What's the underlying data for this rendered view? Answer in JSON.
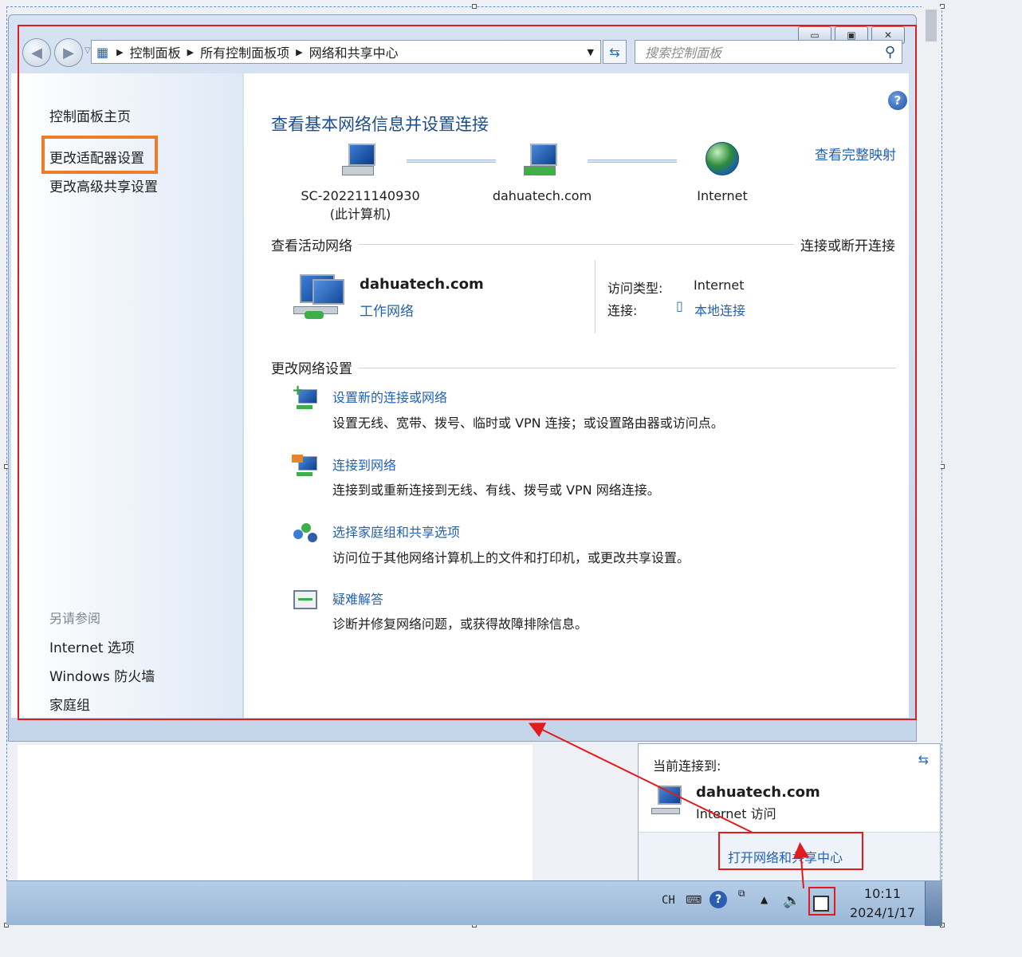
{
  "window": {
    "minimize_icon": "minimize-icon",
    "maximize_icon": "maximize-icon",
    "close_icon": "close-icon"
  },
  "address_bar": {
    "segments": [
      "控制面板",
      "所有控制面板项",
      "网络和共享中心"
    ],
    "search_placeholder": "搜索控制面板"
  },
  "sidebar": {
    "home": "控制面板主页",
    "change_adapter": "更改适配器设置",
    "change_advanced": "更改高级共享设置",
    "see_also_label": "另请参阅",
    "see_also": [
      "Internet 选项",
      "Windows 防火墙",
      "家庭组"
    ]
  },
  "main": {
    "heading": "查看基本网络信息并设置连接",
    "full_map": "查看完整映射",
    "map": {
      "computer_name": "SC-202211140930",
      "computer_sub": "(此计算机)",
      "network_name": "dahuatech.com",
      "internet": "Internet"
    },
    "active_title": "查看活动网络",
    "connect_disconnect": "连接或断开连接",
    "active_network": {
      "name": "dahuatech.com",
      "type": "工作网络",
      "access_label": "访问类型:",
      "access_value": "Internet",
      "conn_label": "连接:",
      "conn_value": "本地连接"
    },
    "change_title": "更改网络设置",
    "tasks": [
      {
        "title": "设置新的连接或网络",
        "desc": "设置无线、宽带、拨号、临时或 VPN 连接；或设置路由器或访问点。"
      },
      {
        "title": "连接到网络",
        "desc": "连接到或重新连接到无线、有线、拨号或 VPN 网络连接。"
      },
      {
        "title": "选择家庭组和共享选项",
        "desc": "访问位于其他网络计算机上的文件和打印机，或更改共享设置。"
      },
      {
        "title": "疑难解答",
        "desc": "诊断并修复网络问题，或获得故障排除信息。"
      }
    ]
  },
  "popup": {
    "current_label": "当前连接到:",
    "network": "dahuatech.com",
    "access": "Internet 访问",
    "open_center": "打开网络和共享中心"
  },
  "taskbar": {
    "lang": "CH",
    "time": "10:11",
    "date": "2024/1/17"
  },
  "colors": {
    "highlight_red": "#e21c1c",
    "highlight_orange": "#ee7d2a",
    "link_blue": "#2262b5"
  }
}
